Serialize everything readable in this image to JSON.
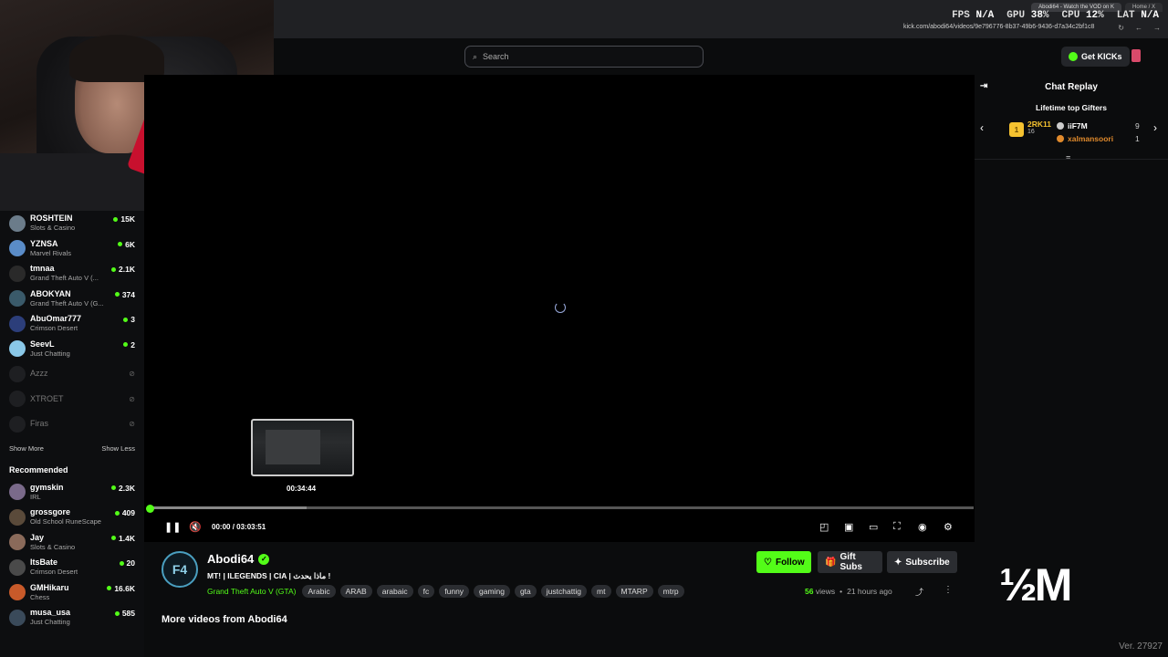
{
  "browser": {
    "tabs": [
      "Abodi64 - Watch the VOD on K",
      "Home / X"
    ],
    "url": "kick.com/abodi64/videos/9e796776-8b37-49b6-9436-d7a34c2bf1c8"
  },
  "hud": {
    "fps_label": "FPS",
    "fps": "N/A",
    "gpu_label": "GPU",
    "gpu": "38",
    "cpu_label": "CPU",
    "cpu": "12",
    "lat_label": "LAT",
    "lat": "N/A"
  },
  "header": {
    "search_placeholder": "Search",
    "get_kicks": "Get KICKs"
  },
  "sidebar": {
    "channels": [
      {
        "name": "ROSHTEIN",
        "category": "Slots & Casino",
        "viewers": "15K",
        "color": "#6b7c8a"
      },
      {
        "name": "YZNSA",
        "category": "Marvel Rivals",
        "viewers": "6K",
        "color": "#5a8cc8"
      },
      {
        "name": "tmnaa",
        "category": "Grand Theft Auto V (...",
        "viewers": "2.1K",
        "color": "#2a2a2a"
      },
      {
        "name": "ABOKYAN",
        "category": "Grand Theft Auto V (G...",
        "viewers": "374",
        "color": "#3a5a6a"
      },
      {
        "name": "AbuOmar777",
        "category": "Crimson Desert",
        "viewers": "3",
        "color": "#2c3e7a"
      },
      {
        "name": "SeevL",
        "category": "Just Chatting",
        "viewers": "2",
        "color": "#8ac8e8"
      }
    ],
    "offline": [
      "Azzz",
      "XTROET",
      "Firas"
    ],
    "show_more": "Show More",
    "show_less": "Show Less",
    "recommended_title": "Recommended",
    "recommended": [
      {
        "name": "gymskin",
        "category": "IRL",
        "viewers": "2.3K",
        "color": "#7a6a8a"
      },
      {
        "name": "grossgore",
        "category": "Old School RuneScape",
        "viewers": "409",
        "color": "#5a4a3a"
      },
      {
        "name": "Jay",
        "category": "Slots & Casino",
        "viewers": "1.4K",
        "color": "#8a6a5a"
      },
      {
        "name": "ItsBate",
        "category": "Crimson Desert",
        "viewers": "20",
        "color": "#4a4a4a"
      },
      {
        "name": "GMHikaru",
        "category": "Chess",
        "viewers": "16.6K",
        "color": "#c85a2a"
      },
      {
        "name": "musa_usa",
        "category": "Just Chatting",
        "viewers": "585",
        "color": "#3a4a5a"
      }
    ]
  },
  "player": {
    "preview_time": "00:34:44",
    "current_time": "00:00",
    "duration": "03:03:51",
    "buffered_fraction": 0.19
  },
  "chat": {
    "title": "Chat Replay",
    "gifters_title": "Lifetime top Gifters",
    "top_gifter": {
      "rank": "1",
      "name": "2RK11",
      "count": "16"
    },
    "gifters": [
      {
        "name": "iiF7M",
        "count": "9"
      },
      {
        "name": "xalmansoori",
        "count": "1"
      }
    ]
  },
  "info": {
    "streamer": "Abodi64",
    "title": "MT! | ILEGENDS | CIA | ماذا يحدث !",
    "game": "Grand Theft Auto V (GTA)",
    "tags": [
      "Arabic",
      "ARAB",
      "arabaic",
      "fc",
      "funny",
      "gaming",
      "gta",
      "justchattig",
      "mt",
      "MTARP",
      "mtrp"
    ],
    "follow": "Follow",
    "gift_subs": "Gift Subs",
    "subscribe": "Subscribe",
    "views_count": "56",
    "views_label": "views",
    "time_ago": "21 hours ago",
    "more_videos": "More videos from Abodi64"
  },
  "watermark": "½M",
  "version": "Ver. 27927",
  "colors": {
    "accent": "#53fc18",
    "gold": "#f5c230"
  }
}
